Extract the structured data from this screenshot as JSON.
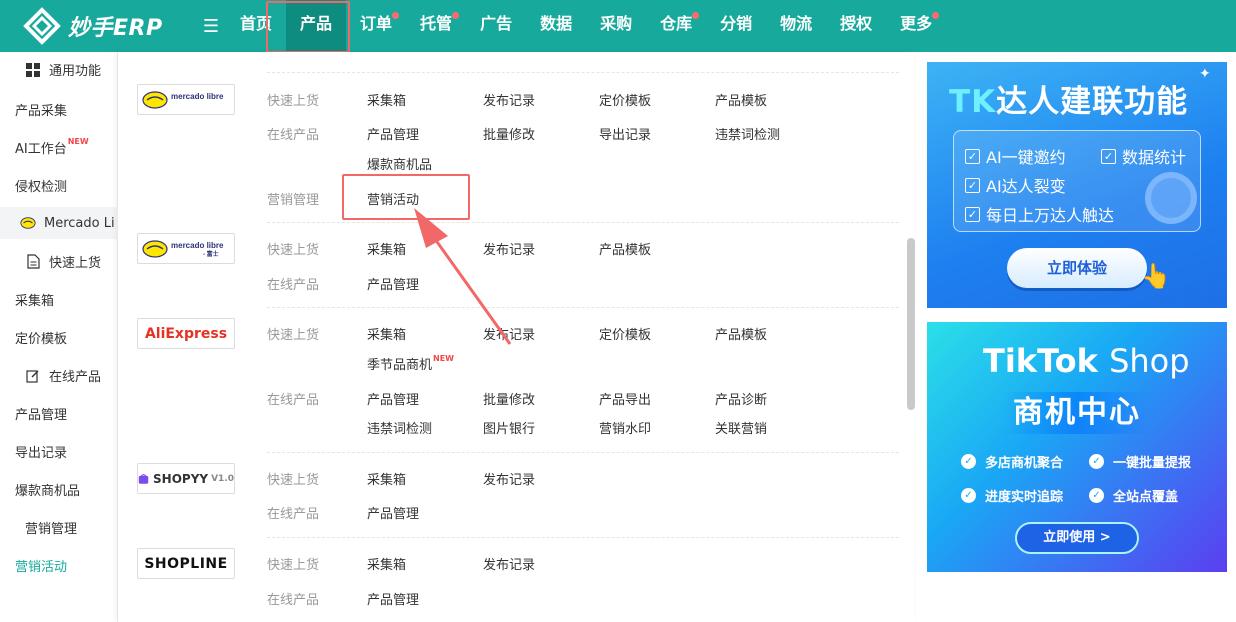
{
  "app": {
    "logo_text": "妙手ERP"
  },
  "nav": {
    "items": [
      {
        "label": "首页",
        "dot": false
      },
      {
        "label": "产品",
        "dot": false,
        "active": true
      },
      {
        "label": "订单",
        "dot": true
      },
      {
        "label": "托管",
        "dot": true
      },
      {
        "label": "广告",
        "dot": false
      },
      {
        "label": "数据",
        "dot": false
      },
      {
        "label": "采购",
        "dot": false
      },
      {
        "label": "仓库",
        "dot": true
      },
      {
        "label": "分销",
        "dot": false
      },
      {
        "label": "物流",
        "dot": false
      },
      {
        "label": "授权",
        "dot": false
      },
      {
        "label": "更多",
        "dot": true
      }
    ]
  },
  "sidebar": {
    "items": [
      {
        "label": "通用功能"
      },
      {
        "label": "产品采集"
      },
      {
        "label": "AI工作台",
        "badge": "NEW"
      },
      {
        "label": "侵权检测"
      },
      {
        "label": "Mercado Li"
      },
      {
        "label": "快速上货"
      },
      {
        "label": "采集箱"
      },
      {
        "label": "定价模板"
      },
      {
        "label": "在线产品"
      },
      {
        "label": "产品管理"
      },
      {
        "label": "导出记录"
      },
      {
        "label": "爆款商机品"
      },
      {
        "label": "营销管理"
      },
      {
        "label": "营销活动"
      }
    ]
  },
  "panel": {
    "mercado1": {
      "logo": "mercado libre",
      "label_quick": "快速上货",
      "label_online": "在线产品",
      "label_marketing": "营销管理",
      "quick": [
        "采集箱",
        "发布记录",
        "定价模板",
        "产品模板"
      ],
      "online": [
        "产品管理",
        "批量修改",
        "导出记录",
        "违禁词检测",
        "爆款商机品"
      ],
      "marketing": [
        "营销活动"
      ]
    },
    "mercado2": {
      "logo": "mercado libre",
      "logo_suffix": "- 富士",
      "label_quick": "快速上货",
      "label_online": "在线产品",
      "quick": [
        "采集箱",
        "发布记录",
        "产品模板"
      ],
      "online": [
        "产品管理"
      ]
    },
    "aliexpress": {
      "logo": "AliExpress",
      "label_quick": "快速上货",
      "label_online": "在线产品",
      "quick": [
        "采集箱",
        "发布记录",
        "定价模板",
        "产品模板",
        "季节品商机"
      ],
      "quick_new_badge": "NEW",
      "online": [
        "产品管理",
        "批量修改",
        "产品导出",
        "产品诊断",
        "违禁词检测",
        "图片银行",
        "营销水印",
        "关联营销"
      ]
    },
    "shopyy": {
      "logo": "SHOPYY",
      "logo_version": "V1.0",
      "label_quick": "快速上货",
      "label_online": "在线产品",
      "quick": [
        "采集箱",
        "发布记录"
      ],
      "online": [
        "产品管理"
      ]
    },
    "shopline": {
      "logo": "SHOPLINE",
      "label_quick": "快速上货",
      "label_online": "在线产品",
      "quick": [
        "采集箱",
        "发布记录"
      ],
      "online": [
        "产品管理"
      ]
    }
  },
  "ads": {
    "tk": {
      "title_tk": "TK",
      "title_rest": "达人建联功能",
      "features": [
        "AI一键邀约",
        "数据统计",
        "AI达人裂变",
        "每日上万达人触达"
      ],
      "cta": "立即体验"
    },
    "tiktok_shop": {
      "brand": "TikTok",
      "brand_shop": "Shop",
      "subtitle": "商机中心",
      "features": [
        "多店商机聚合",
        "一键批量提报",
        "进度实时追踪",
        "全站点覆盖"
      ],
      "cta": "立即使用 >"
    }
  },
  "colors": {
    "brand": "#17a99b",
    "highlight": "#f26868",
    "active_link": "#17a99b"
  }
}
